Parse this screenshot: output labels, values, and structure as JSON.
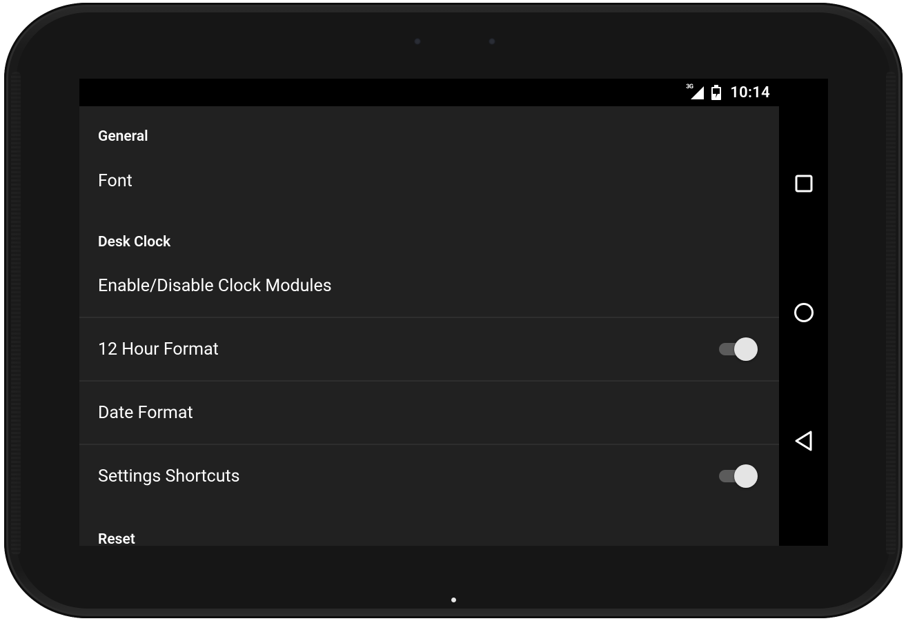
{
  "status_bar": {
    "network_type": "3G",
    "time": "10:14",
    "icons": [
      "signal-icon",
      "battery-charging-icon"
    ]
  },
  "settings": {
    "general_header": "General",
    "font_label": "Font",
    "desk_clock_header": "Desk Clock",
    "clock_modules_label": "Enable/Disable Clock Modules",
    "hour_format_label": "12 Hour Format",
    "hour_format_enabled": true,
    "date_format_label": "Date Format",
    "settings_shortcuts_label": "Settings Shortcuts",
    "settings_shortcuts_enabled": true,
    "reset_header": "Reset"
  },
  "nav_bar": {
    "icons": [
      "recent-apps-icon",
      "home-icon",
      "back-icon"
    ]
  },
  "colors": {
    "background": "#212121",
    "status_bar": "#000000",
    "text": "#ffffff",
    "divider": "#2e2e2e"
  }
}
